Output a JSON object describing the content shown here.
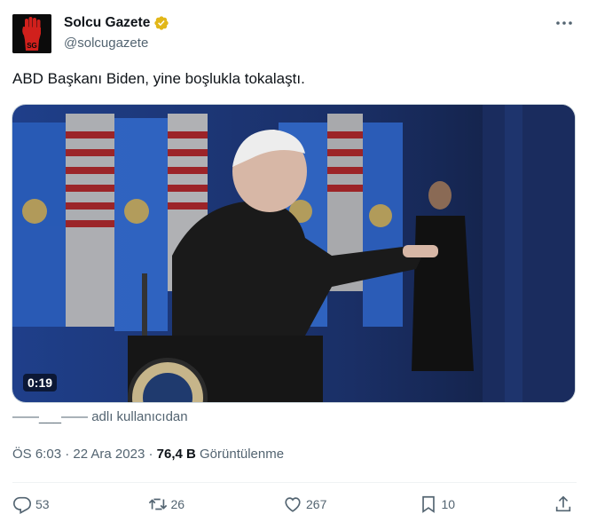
{
  "author": {
    "display_name": "Solcu Gazete",
    "handle": "@solcugazete",
    "avatar_icon": "raised-fist-icon",
    "avatar_text": "SG",
    "verified_color": "#e2b719"
  },
  "tweet": {
    "text": "ABD Başkanı Biden, yine boşlukla tokalaştı."
  },
  "media": {
    "type": "video",
    "duration": "0:19"
  },
  "source_attribution": "——___—— adlı kullanıcıdan",
  "meta": {
    "time": "ÖS 6:03",
    "separator": "·",
    "date": "22 Ara 2023",
    "views_count": "76,4 B",
    "views_label": "Görüntülenme"
  },
  "actions": {
    "replies": "53",
    "reposts": "26",
    "likes": "267",
    "bookmarks": "10"
  },
  "colors": {
    "text_primary": "#0f1419",
    "text_secondary": "#536471",
    "border": "#cfd9de",
    "divider": "#eff3f4"
  }
}
